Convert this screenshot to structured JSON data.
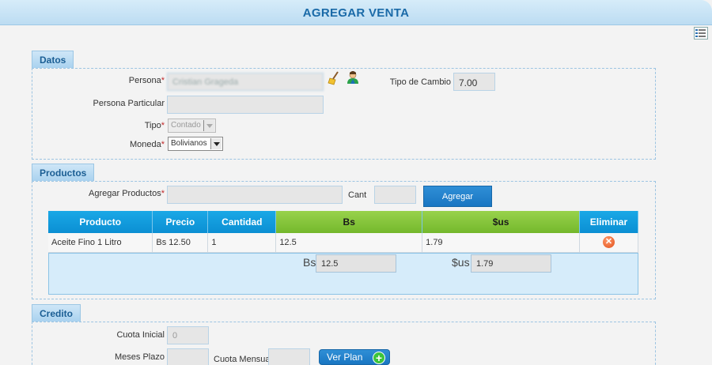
{
  "header": {
    "title": "AGREGAR VENTA"
  },
  "datos": {
    "section_label": "Datos",
    "persona_label": "Persona",
    "persona_value": "Cristian Grageda",
    "persona_particular_label": "Persona Particular",
    "persona_particular_value": "",
    "tipo_label": "Tipo",
    "tipo_value": "Contado",
    "moneda_label": "Moneda",
    "moneda_value": "Bolivianos",
    "tipo_cambio_label": "Tipo de Cambio",
    "tipo_cambio_value": "7.00",
    "required_mark": "*"
  },
  "productos": {
    "section_label": "Productos",
    "agregar_label": "Agregar Productos",
    "agregar_value": "",
    "cant_label": "Cant",
    "cant_value": "",
    "agregar_button": "Agregar",
    "columns": [
      "Producto",
      "Precio",
      "Cantidad",
      "Bs",
      "$us",
      "Eliminar"
    ],
    "rows": [
      {
        "producto": "Aceite Fino 1 Litro",
        "precio": "Bs 12.50",
        "cantidad": "1",
        "bs": "12.5",
        "usd": "1.79"
      }
    ],
    "total_bs_label": "Bs",
    "total_bs_value": "12.5",
    "total_usd_label": "$us",
    "total_usd_value": "1.79"
  },
  "credito": {
    "section_label": "Credito",
    "cuota_inicial_label": "Cuota Inicial",
    "cuota_inicial_value": "0",
    "meses_plazo_label": "Meses Plazo",
    "meses_plazo_value": "",
    "cuota_mensual_label": "Cuota Mensual",
    "cuota_mensual_value": "",
    "ver_plan_button": "Ver Plan"
  },
  "colors": {
    "accent": "#1b5e94",
    "table_header": "#0b8fd3",
    "green_header": "#74b82c",
    "button": "#1976c2"
  }
}
